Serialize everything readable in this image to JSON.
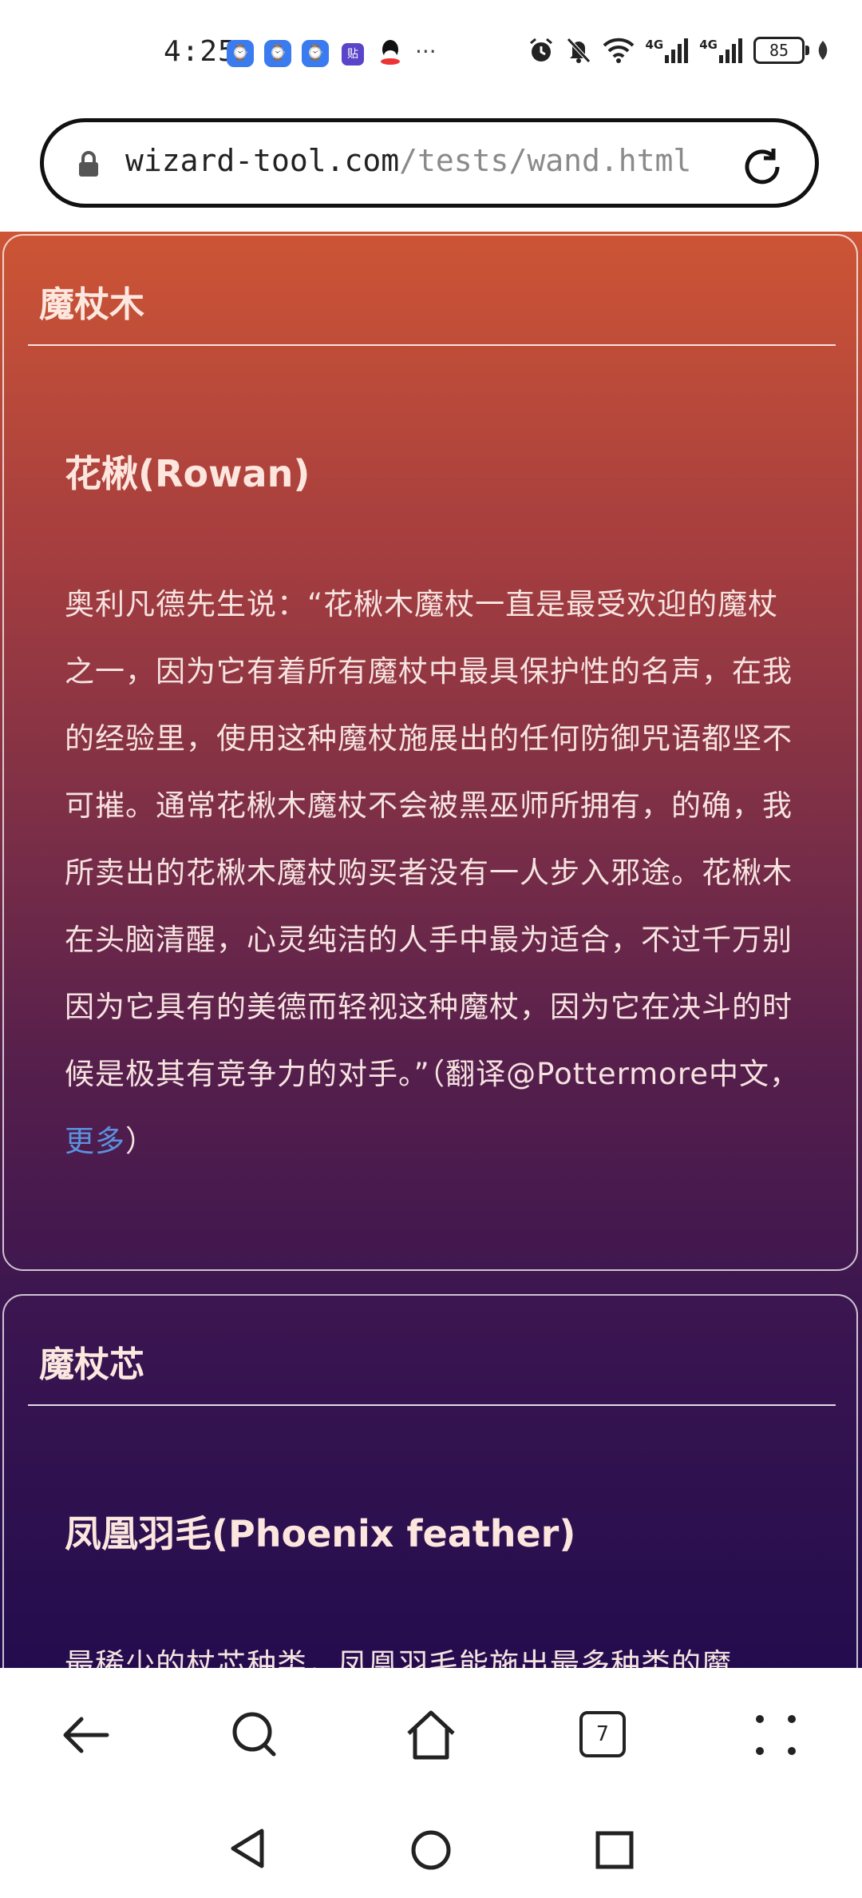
{
  "status_bar": {
    "time": "4:25",
    "notification_icons": [
      "app-icon",
      "app-icon",
      "app-icon",
      "tieba-icon",
      "qq-icon",
      "more-dots-icon"
    ],
    "tieba_glyph": "贴",
    "more_glyph": "···",
    "signal_1_label": "4G",
    "signal_2_label": "4G",
    "battery": "85"
  },
  "url_bar": {
    "domain": "wizard-tool.com",
    "path": "/tests/wand.html"
  },
  "wood_card": {
    "heading": "魔杖木",
    "item_title": "花楸(Rowan)",
    "description": "奥利凡德先生说：“花楸木魔杖一直是最受欢迎的魔杖之一，因为它有着所有魔杖中最具保护性的名声，在我的经验里，使用这种魔杖施展出的任何防御咒语都坚不可摧。通常花楸木魔杖不会被黑巫师所拥有，的确，我所卖出的花楸木魔杖购买者没有一人步入邪途。花楸木在头脑清醒，心灵纯洁的人手中最为适合，不过千万别因为它具有的美德而轻视这种魔杖，因为它在决斗的时候是极其有竞争力的对手。”（翻译@Pottermore中文，",
    "more_link": "更多",
    "closing": "）"
  },
  "core_card": {
    "heading": "魔杖芯",
    "item_title": "凤凰羽毛(Phoenix feather)",
    "description": "最稀少的杖芯种类，凤凰羽毛能施出最多种类的魔"
  },
  "browser_nav": {
    "tab_count": "7",
    "buttons": [
      "back-icon",
      "search-icon",
      "home-icon",
      "tabs-icon",
      "menu-dots-icon"
    ]
  },
  "system_nav": {
    "buttons": [
      "back-triangle-icon",
      "home-circle-icon",
      "recents-square-icon"
    ]
  }
}
